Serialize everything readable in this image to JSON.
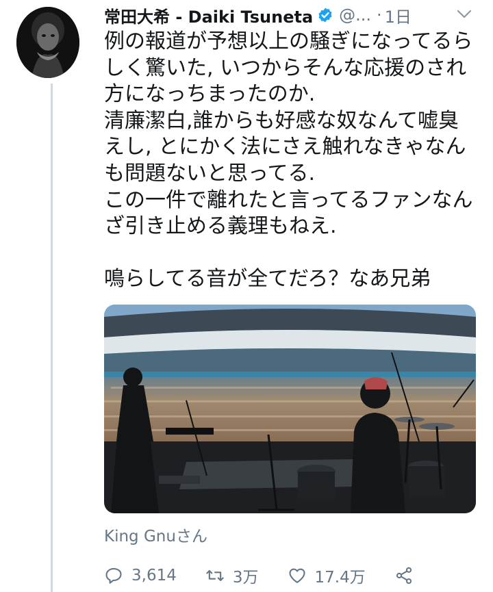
{
  "tweet": {
    "display_name": "常田大希 - Daiki Tsuneta",
    "handle": "@...",
    "separator": "·",
    "time": "1日",
    "lines": [
      "例の報道が予想以上の騒ぎになってるら",
      "しく驚いた, いつからそんな応援のされ",
      "方になっちまったのか.",
      "清廉潔白,誰からも好感な奴なんて嘘臭",
      "えし, とにかく法にさえ触れなきゃなん",
      "も問題ないと思ってる.",
      "この一件で離れたと言ってるファンなん",
      "ざ引き止める義理もねえ.",
      "",
      "鳴らしてる音が全てだろ？なあ兄弟"
    ],
    "tagged_user": "King Gnuさん"
  },
  "actions": {
    "replies": "3,614",
    "retweets": "3万",
    "likes": "17.4万"
  },
  "colors": {
    "text": "#14171a",
    "secondary": "#657786",
    "verified": "#1da1f2",
    "thread_line": "#cfd9de"
  },
  "icons": [
    "avatar",
    "verified-badge-icon",
    "chevron-down-icon",
    "reply-icon",
    "retweet-icon",
    "like-icon",
    "share-icon"
  ]
}
